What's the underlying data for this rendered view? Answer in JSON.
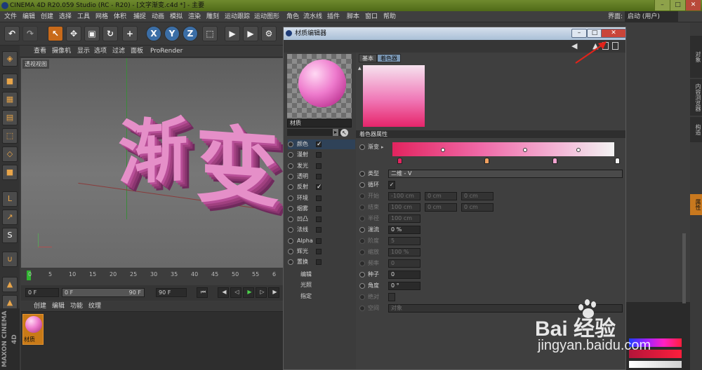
{
  "titlebar": {
    "title": "CINEMA 4D R20.059 Studio (RC - R20) - [文字渐变.c4d *] - 主要"
  },
  "menubar": {
    "items": [
      "文件",
      "编辑",
      "创建",
      "选择",
      "工具",
      "网格",
      "体积",
      "捕捉",
      "动画",
      "模拟",
      "渲染",
      "雕刻",
      "运动跟踪",
      "运动图形",
      "角色",
      "流水线",
      "插件",
      "脚本",
      "窗口",
      "帮助"
    ],
    "layout_label": "界面:",
    "layout_value": "启动 (用户)"
  },
  "viewport": {
    "menu": [
      "查看",
      "摄像机",
      "显示",
      "选项",
      "过滤",
      "面板",
      "ProRender"
    ],
    "label": "透视视图",
    "text_chars": [
      "渐",
      "变"
    ]
  },
  "timeline": {
    "ticks": [
      "0",
      "5",
      "10",
      "15",
      "20",
      "25",
      "30",
      "35",
      "40",
      "45",
      "50",
      "55",
      "6"
    ],
    "start": "0 F",
    "range_start": "0 F",
    "range_end": "90 F",
    "end": "90 F"
  },
  "material_manager": {
    "menu": [
      "创建",
      "编辑",
      "功能",
      "纹理"
    ],
    "material_label": "材质"
  },
  "branding": {
    "text": "MAXON CINEMA 4D"
  },
  "right_panel": {
    "tabs": [
      "对象",
      "内容浏览器",
      "构造",
      "属性"
    ]
  },
  "material_editor": {
    "title": "材质编辑器",
    "material_name": "材质",
    "channels": [
      {
        "label": "颜色",
        "checked": "✓",
        "selected": true
      },
      {
        "label": "漫射",
        "checked": "",
        "selected": false
      },
      {
        "label": "发光",
        "checked": "",
        "selected": false
      },
      {
        "label": "透明",
        "checked": "",
        "selected": false
      },
      {
        "label": "反射",
        "checked": "✓",
        "selected": false
      },
      {
        "label": "环境",
        "checked": "",
        "selected": false
      },
      {
        "label": "烟雾",
        "checked": "",
        "selected": false
      },
      {
        "label": "凹凸",
        "checked": "",
        "selected": false
      },
      {
        "label": "法线",
        "checked": "",
        "selected": false
      },
      {
        "label": "Alpha",
        "checked": "",
        "selected": false
      },
      {
        "label": "辉光",
        "checked": "",
        "selected": false
      },
      {
        "label": "置换",
        "checked": "",
        "selected": false
      }
    ],
    "extra_items": [
      "编辑",
      "光照",
      "指定"
    ],
    "tabs": [
      "基本",
      "着色器"
    ],
    "section_title": "着色器属性",
    "gradient_label": "渐变",
    "props": {
      "type_label": "类型",
      "type_value": "二维 - V",
      "cycle_label": "循环",
      "cycle_check": "✓",
      "start_label": "开始",
      "start_vals": [
        "-100 cm",
        "0 cm",
        "0 cm"
      ],
      "end_label": "结束",
      "end_vals": [
        "100 cm",
        "0 cm",
        "0 cm"
      ],
      "radius_label": "半径",
      "radius_val": "100 cm",
      "turb_label": "湍流",
      "turb_val": "0 %",
      "octave_label": "阶度",
      "octave_val": "5",
      "scale_label": "缩放",
      "scale_val": "100 %",
      "freq_label": "频率",
      "freq_val": "0",
      "seed_label": "种子",
      "seed_val": "0",
      "angle_label": "角度",
      "angle_val": "0 °",
      "absolute_label": "绝对",
      "space_label": "空间",
      "space_val": "对象"
    }
  },
  "watermark": {
    "brand": "Bai 经验",
    "url": "jingyan.baidu.com"
  },
  "colors": {
    "accent": "#e6246a",
    "pink": "#f07ab8",
    "highlight": "#c86a1a"
  }
}
